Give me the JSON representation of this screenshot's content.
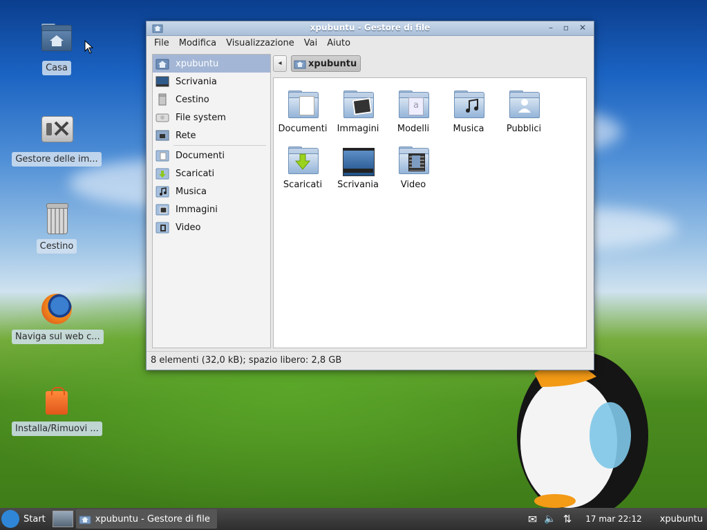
{
  "desktop": {
    "icons": [
      {
        "label": "Casa",
        "icon": "home-folder-icon"
      },
      {
        "label": "Gestore delle im...",
        "icon": "settings-manager-icon"
      },
      {
        "label": "Cestino",
        "icon": "trash-icon"
      },
      {
        "label": "Naviga sul web c...",
        "icon": "firefox-icon"
      },
      {
        "label": "Installa/Rimuovi ...",
        "icon": "software-center-icon"
      }
    ]
  },
  "window": {
    "title": "xpubuntu - Gestore di file",
    "menu": [
      "File",
      "Modifica",
      "Visualizzazione",
      "Vai",
      "Aiuto"
    ],
    "sidebar": {
      "places": [
        {
          "label": "xpubuntu",
          "icon": "home-icon",
          "selected": true
        },
        {
          "label": "Scrivania",
          "icon": "desktop-icon"
        },
        {
          "label": "Cestino",
          "icon": "trash-icon"
        },
        {
          "label": "File system",
          "icon": "drive-icon"
        },
        {
          "label": "Rete",
          "icon": "network-icon"
        }
      ],
      "bookmarks": [
        {
          "label": "Documenti",
          "icon": "documents-folder-icon"
        },
        {
          "label": "Scaricati",
          "icon": "downloads-folder-icon"
        },
        {
          "label": "Musica",
          "icon": "music-folder-icon"
        },
        {
          "label": "Immagini",
          "icon": "pictures-folder-icon"
        },
        {
          "label": "Video",
          "icon": "video-folder-icon"
        }
      ]
    },
    "path": {
      "back": "◂",
      "current": "xpubuntu"
    },
    "files": [
      {
        "label": "Documenti",
        "icon": "documents-folder-icon"
      },
      {
        "label": "Immagini",
        "icon": "pictures-folder-icon"
      },
      {
        "label": "Modelli",
        "icon": "templates-folder-icon"
      },
      {
        "label": "Musica",
        "icon": "music-folder-icon"
      },
      {
        "label": "Pubblici",
        "icon": "public-folder-icon"
      },
      {
        "label": "Scaricati",
        "icon": "downloads-folder-icon"
      },
      {
        "label": "Scrivania",
        "icon": "desktop-folder-icon"
      },
      {
        "label": "Video",
        "icon": "video-folder-icon"
      }
    ],
    "status": "8 elementi (32,0 kB); spazio libero: 2,8 GB"
  },
  "taskbar": {
    "start_label": "Start",
    "task_title": "xpubuntu - Gestore di file",
    "clock": "17 mar  22:12",
    "user": "xpubuntu"
  }
}
